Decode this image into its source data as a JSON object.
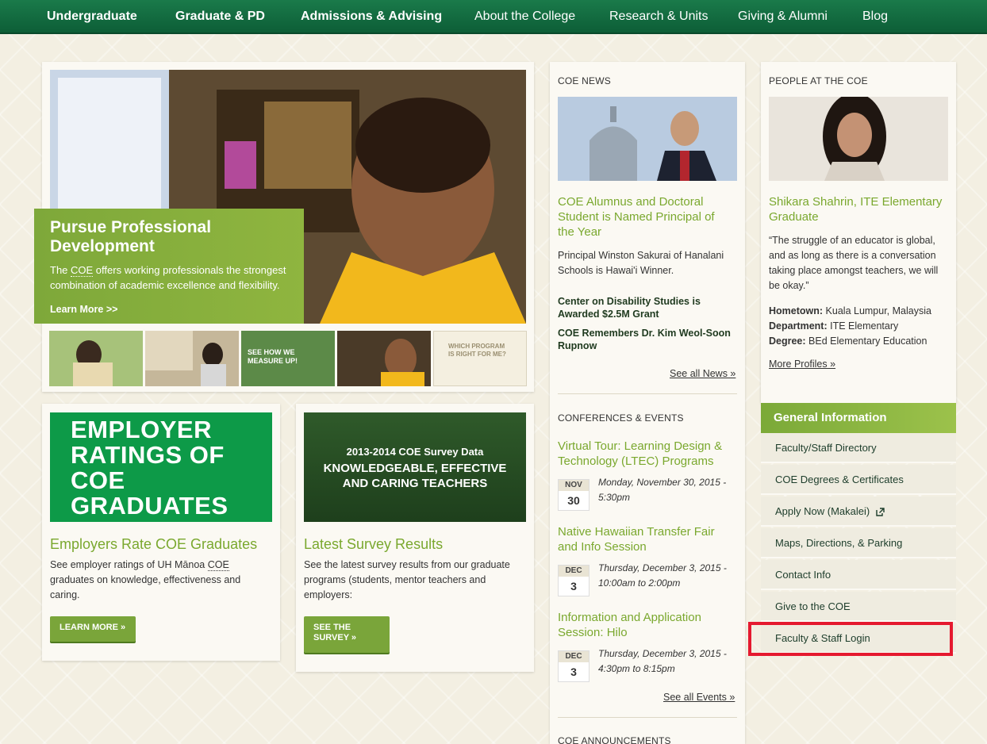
{
  "nav": {
    "items": [
      {
        "label": "Undergraduate",
        "bold": true
      },
      {
        "label": "Graduate & PD",
        "bold": true
      },
      {
        "label": "Admissions & Advising",
        "bold": true
      },
      {
        "label": "About the College",
        "bold": false
      },
      {
        "label": "Research & Units",
        "bold": false
      },
      {
        "label": "Giving & Alumni",
        "bold": false
      },
      {
        "label": "Blog",
        "bold": false
      }
    ]
  },
  "hero": {
    "title": "Pursue Professional Development",
    "text_pre": "The ",
    "text_abbr": "COE",
    "text_post": " offers working professionals the strongest combination of academic excellence and flexibility.",
    "cta": "Learn More >>"
  },
  "thumbs": {
    "measure_label": "SEE HOW WE MEASURE UP!",
    "program_label": "WHICH PROGRAM IS RIGHT FOR ME?"
  },
  "promo1": {
    "image_text": "EMPLOYER RATINGS OF COE GRADUATES",
    "title": "Employers Rate COE Graduates",
    "text_pre": "See employer ratings of UH Mānoa ",
    "text_abbr": "COE",
    "text_post": " graduates on knowledge, effectiveness and caring.",
    "button": "LEARN MORE »"
  },
  "promo2": {
    "image_line1": "2013-2014 COE Survey Data",
    "image_line2": "KNOWLEDGEABLE, EFFECTIVE",
    "image_line3": "AND CARING TEACHERS",
    "title": "Latest Survey Results",
    "text": "See the latest survey results from our graduate programs (students, mentor teachers and employers:",
    "button_line1": "SEE THE",
    "button_line2": "SURVEY »"
  },
  "news": {
    "heading": "COE NEWS",
    "headline": "COE Alumnus and Doctoral Student is Named Principal of the Year",
    "summary": "Principal Winston Sakurai of Hanalani Schools is Hawai'i Winner.",
    "item1": "Center on Disability Studies is Awarded $2.5M Grant",
    "item2": "COE Remembers Dr. Kim Weol-Soon Rupnow",
    "see_all": "See all News »"
  },
  "events": {
    "heading": "CONFERENCES & EVENTS",
    "list": [
      {
        "title": "Virtual Tour: Learning Design & Technology (LTEC) Programs",
        "month": "NOV",
        "day": "30",
        "time": "Monday, November 30, 2015 - 5:30pm"
      },
      {
        "title": "Native Hawaiian Transfer Fair and Info Session",
        "month": "DEC",
        "day": "3",
        "time": "Thursday, December 3, 2015 - 10:00am to 2:00pm"
      },
      {
        "title": "Information and Application Session: Hilo",
        "month": "DEC",
        "day": "3",
        "time": "Thursday, December 3, 2015 - 4:30pm to 8:15pm"
      }
    ],
    "see_all": "See all Events »"
  },
  "announcements": {
    "heading": "COE ANNOUNCEMENTS"
  },
  "people": {
    "heading": "PEOPLE AT THE COE",
    "name": "Shikara Shahrin, ITE Elementary Graduate",
    "quote": "“The struggle of an educator is global, and as long as there is a conversation taking place amongst teachers, we will be okay.”",
    "hometown_label": "Hometown:",
    "hometown": "Kuala Lumpur, Malaysia",
    "department_label": "Department:",
    "department": "ITE Elementary",
    "degree_label": "Degree:",
    "degree": "BEd Elementary Education",
    "more": "More Profiles »"
  },
  "general_info": {
    "heading": "General Information",
    "items": [
      {
        "label": "Faculty/Staff Directory"
      },
      {
        "label": "COE Degrees & Certificates"
      },
      {
        "label": "Apply Now (Makalei)"
      },
      {
        "label": "Maps, Directions, & Parking"
      },
      {
        "label": "Contact Info"
      },
      {
        "label": "Give to the COE"
      },
      {
        "label": "Faculty & Staff Login"
      }
    ]
  },
  "colors": {
    "nav_green": "#0d5e37",
    "accent_green": "#7aa82e",
    "highlight_red": "#e5192f"
  }
}
